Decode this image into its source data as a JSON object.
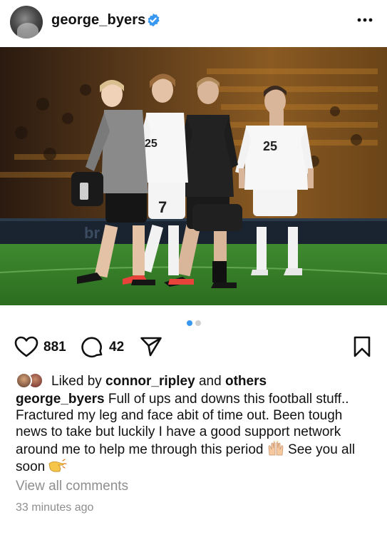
{
  "header": {
    "username": "george_byers",
    "avatar_icon": "profile-avatar",
    "verified_icon": "verified-badge-icon",
    "more_icon": "more-options-icon"
  },
  "post": {
    "photo_icon": "football-players-photo",
    "carousel": {
      "count": 2,
      "active_index": 0
    }
  },
  "actions": {
    "like_count": "881",
    "comment_count": "42",
    "like_icon": "heart-icon",
    "comment_icon": "comment-icon",
    "share_icon": "share-icon",
    "save_icon": "bookmark-icon"
  },
  "likes": {
    "prefix": "Liked by ",
    "user": "connor_ripley",
    "middle": " and ",
    "others": "others"
  },
  "caption": {
    "username": "george_byers",
    "part1": " Full of ups and downs this football stuff.. Fractured my leg and face abit of time out. Been tough news to take but luckily I have a good support network around me to help me through this period ",
    "part2": " See you all soon "
  },
  "comments": {
    "view_all": "View all comments"
  },
  "timestamp": "33 minutes ago",
  "colors": {
    "verified": "#3897f0",
    "muted": "#8e8e8e",
    "active_dot": "#3897f0"
  }
}
